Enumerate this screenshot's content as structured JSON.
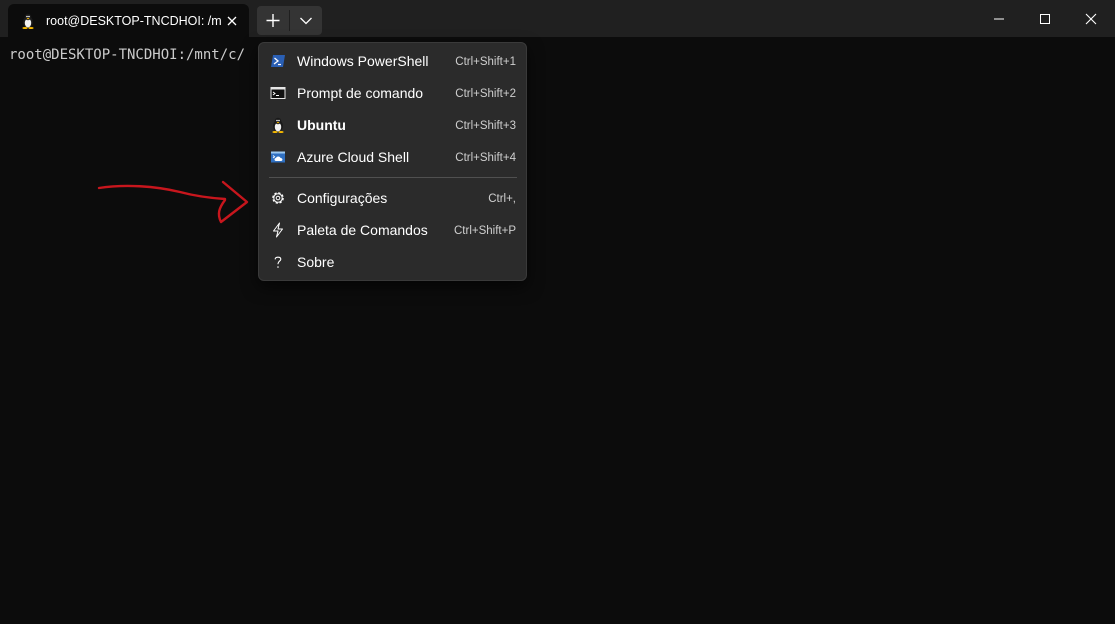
{
  "window": {
    "tab": {
      "title": "root@DESKTOP-TNCDHOI: /mn",
      "icon": "linux-penguin-icon"
    },
    "controls": [
      "minimize-icon",
      "maximize-icon",
      "close-icon"
    ]
  },
  "terminal": {
    "prompt": "root@DESKTOP-TNCDHOI:/mnt/c/"
  },
  "menu": {
    "profiles": [
      {
        "label": "Windows PowerShell",
        "shortcut": "Ctrl+Shift+1",
        "icon": "powershell-icon"
      },
      {
        "label": "Prompt de comando",
        "shortcut": "Ctrl+Shift+2",
        "icon": "command-prompt-icon"
      },
      {
        "label": "Ubuntu",
        "shortcut": "Ctrl+Shift+3",
        "icon": "ubuntu-penguin-icon"
      },
      {
        "label": "Azure Cloud Shell",
        "shortcut": "Ctrl+Shift+4",
        "icon": "azure-cloud-shell-icon"
      }
    ],
    "actions": [
      {
        "label": "Configurações",
        "shortcut": "Ctrl+,",
        "icon": "gear-icon"
      },
      {
        "label": "Paleta de Comandos",
        "shortcut": "Ctrl+Shift+P",
        "icon": "lightning-icon"
      },
      {
        "label": "Sobre",
        "shortcut": "",
        "icon": "question-icon"
      }
    ]
  },
  "colors": {
    "titlebar": "#202020",
    "terminal_bg": "#0c0c0c",
    "menu_bg": "#2b2b2b",
    "annotation_arrow": "#c8161d"
  }
}
